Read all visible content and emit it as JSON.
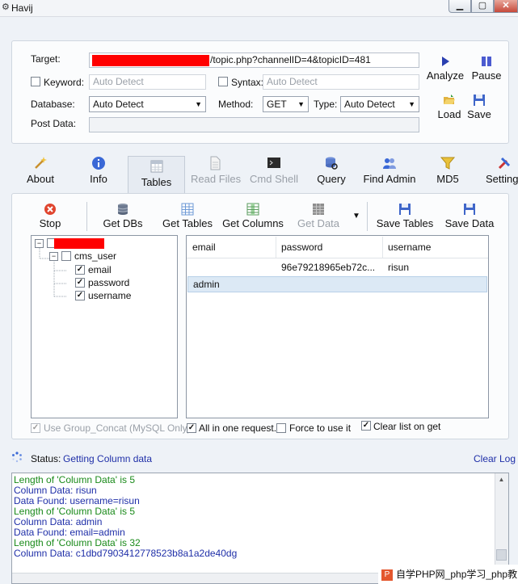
{
  "window": {
    "title": "Havij"
  },
  "target": {
    "label": "Target:",
    "url_suffix": "/topic.php?channelID=4&topicID=481",
    "keyword_label": "Keyword:",
    "keyword_placeholder": "Auto Detect",
    "syntax_label": "Syntax:",
    "syntax_placeholder": "Auto Detect",
    "database_label": "Database:",
    "database_value": "Auto Detect",
    "method_label": "Method:",
    "method_value": "GET",
    "type_label": "Type:",
    "type_value": "Auto Detect",
    "postdata_label": "Post Data:"
  },
  "actions": {
    "analyze": "Analyze",
    "pause": "Pause",
    "load": "Load",
    "save": "Save"
  },
  "tabs": [
    {
      "label": "About"
    },
    {
      "label": "Info"
    },
    {
      "label": "Tables"
    },
    {
      "label": "Read Files"
    },
    {
      "label": "Cmd Shell"
    },
    {
      "label": "Query"
    },
    {
      "label": "Find Admin"
    },
    {
      "label": "MD5"
    },
    {
      "label": "Settings"
    }
  ],
  "toolbar": {
    "stop": "Stop",
    "get_dbs": "Get DBs",
    "get_tables": "Get Tables",
    "get_columns": "Get Columns",
    "get_data": "Get Data",
    "save_tables": "Save Tables",
    "save_data": "Save Data"
  },
  "tree": {
    "table": "cms_user",
    "columns": [
      "email",
      "password",
      "username"
    ]
  },
  "grid": {
    "headers": [
      "email",
      "password",
      "username"
    ],
    "rows": [
      [
        "",
        "96e79218965eb72c...",
        "risun"
      ],
      [
        "admin",
        "",
        ""
      ]
    ]
  },
  "options": {
    "group_concat": "Use Group_Concat (MySQL Only)",
    "all_in_one": "All in one request.",
    "force": "Force to use it",
    "clear_list": "Clear list on get"
  },
  "status": {
    "label": "Status:",
    "value": "Getting Column data",
    "clear_log": "Clear Log"
  },
  "log": [
    {
      "text": "Length of 'Column Data' is 5",
      "color": "#1a8a1a"
    },
    {
      "text": "Column Data: risun",
      "color": "#1f2fa8"
    },
    {
      "text": "Data Found: username=risun",
      "color": "#1f2fa8"
    },
    {
      "text": "Length of 'Column Data' is 5",
      "color": "#1a8a1a"
    },
    {
      "text": "Column Data: admin",
      "color": "#1f2fa8"
    },
    {
      "text": "Data Found: email=admin",
      "color": "#1f2fa8"
    },
    {
      "text": "Length of 'Column Data' is 32",
      "color": "#1a8a1a"
    },
    {
      "text": "Column Data: c1dbd7903412778523b8a1a2de40dg",
      "color": "#1f2fa8"
    }
  ],
  "watermark": {
    "text": "自学PHP网_php学习_php教"
  }
}
